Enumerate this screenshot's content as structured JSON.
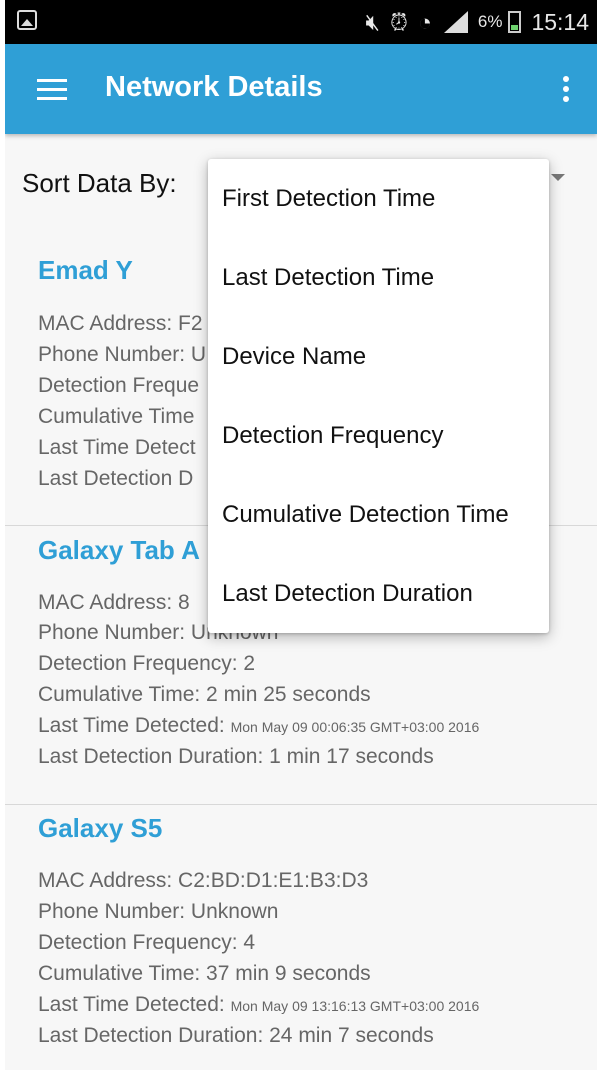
{
  "status_bar": {
    "battery": "6%",
    "time": "15:14",
    "icons": [
      "image-icon",
      "mute-icon",
      "alarm-icon",
      "wifi-icon",
      "signal-icon",
      "battery-icon"
    ]
  },
  "app_bar": {
    "title": "Network Details",
    "color": "#2f9fd6"
  },
  "sort": {
    "label": "Sort Data By:",
    "options": [
      "First Detection Time",
      "Last Detection Time",
      "Device Name",
      "Detection Frequency",
      "Cumulative Detection Time",
      "Last Detection Duration"
    ]
  },
  "devices": [
    {
      "name": "Emad Y",
      "mac_label": "MAC Address: F2",
      "phone_label": "Phone Number: U",
      "freq_label": "Detection Freque",
      "cum_label": "Cumulative Time",
      "last_label": "Last Time Detect",
      "dur_label": "Last Detection D"
    },
    {
      "name": "Galaxy Tab A",
      "mac_label": "MAC Address: 8",
      "phone_label": "Phone Number: Unknown",
      "freq_label": "Detection Frequency: 2",
      "cum_label": "Cumulative Time: 2 min 25 seconds",
      "last_label": "Last Time Detected:",
      "last_value": "Mon May 09 00:06:35 GMT+03:00 2016",
      "dur_label": "Last Detection Duration: 1 min 17 seconds"
    },
    {
      "name": "Galaxy S5",
      "mac_label": "MAC Address: C2:BD:D1:E1:B3:D3",
      "phone_label": "Phone Number: Unknown",
      "freq_label": "Detection Frequency: 4",
      "cum_label": "Cumulative Time: 37 min 9 seconds",
      "last_label": "Last Time Detected:",
      "last_value": "Mon May 09 13:16:13 GMT+03:00 2016",
      "dur_label": "Last Detection Duration: 24 min 7 seconds"
    }
  ]
}
